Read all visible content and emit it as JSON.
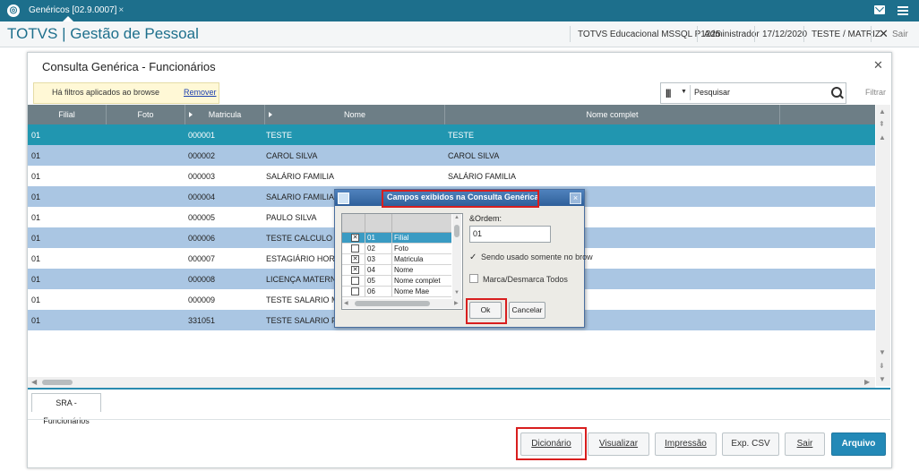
{
  "topbar": {
    "tab_label": "Genéricos [02.9.0007]",
    "tab_close": "×"
  },
  "header": {
    "app_title": "TOTVS | Gestão de Pessoal",
    "environment": "TOTVS Educacional MSSQL P1225",
    "user": "Administrador",
    "date": "17/12/2020",
    "company": "TESTE / MATRIZ",
    "exit_label": "Sair"
  },
  "window": {
    "title": "Consulta Genérica - Funcionários",
    "filter_notice": "Há filtros aplicados ao browse",
    "filter_remove": "Remover",
    "search_placeholder": "Pesquisar",
    "filter_label": "Filtrar",
    "columns": [
      "Filial",
      "Foto",
      "Matricula",
      "Nome",
      "Nome complet"
    ],
    "rows": [
      {
        "filial": "01",
        "matricula": "000001",
        "nome": "TESTE",
        "nome_completo": "TESTE"
      },
      {
        "filial": "01",
        "matricula": "000002",
        "nome": "CAROL SILVA",
        "nome_completo": "CAROL SILVA"
      },
      {
        "filial": "01",
        "matricula": "000003",
        "nome": "SALÁRIO FAMILIA",
        "nome_completo": "SALÁRIO FAMILIA"
      },
      {
        "filial": "01",
        "matricula": "000004",
        "nome": "SALARIO FAMILIA PR",
        "nome_completo": ""
      },
      {
        "filial": "01",
        "matricula": "000005",
        "nome": "PAULO SILVA",
        "nome_completo": ""
      },
      {
        "filial": "01",
        "matricula": "000006",
        "nome": "TESTE CALCULO AUT",
        "nome_completo": ""
      },
      {
        "filial": "01",
        "matricula": "000007",
        "nome": "ESTAGIÁRIO HORIST",
        "nome_completo": ""
      },
      {
        "filial": "01",
        "matricula": "000008",
        "nome": "LICENÇA MATERNIDA",
        "nome_completo": ""
      },
      {
        "filial": "01",
        "matricula": "000009",
        "nome": "TESTE SALARIO MAT",
        "nome_completo": ""
      },
      {
        "filial": "01",
        "matricula": "331051",
        "nome": "TESTE SALARIO FAM",
        "nome_completo": ""
      }
    ],
    "subtab": "SRA - Funcionários",
    "buttons": {
      "dicionario": "Dicionário",
      "visualizar": "Visualizar",
      "impressao": "Impressão",
      "exp_csv": "Exp. CSV",
      "sair": "Sair",
      "arquivo": "Arquivo"
    }
  },
  "dialog": {
    "title": "Campos exibidos na Consulta Genérica",
    "fields": [
      {
        "code": "01",
        "name": "Filial",
        "checked": true
      },
      {
        "code": "02",
        "name": "Foto",
        "checked": false
      },
      {
        "code": "03",
        "name": "Matricula",
        "checked": true
      },
      {
        "code": "04",
        "name": "Nome",
        "checked": true
      },
      {
        "code": "05",
        "name": "Nome complet",
        "checked": false
      },
      {
        "code": "06",
        "name": "Nome Mae",
        "checked": false
      }
    ],
    "order_label": "&Ordem:",
    "order_value": "01",
    "only_browse_label": "Sendo usado somente no brow",
    "toggle_all_label": "Marca/Desmarca Todos",
    "ok_label": "Ok",
    "cancel_label": "Cancelar"
  }
}
